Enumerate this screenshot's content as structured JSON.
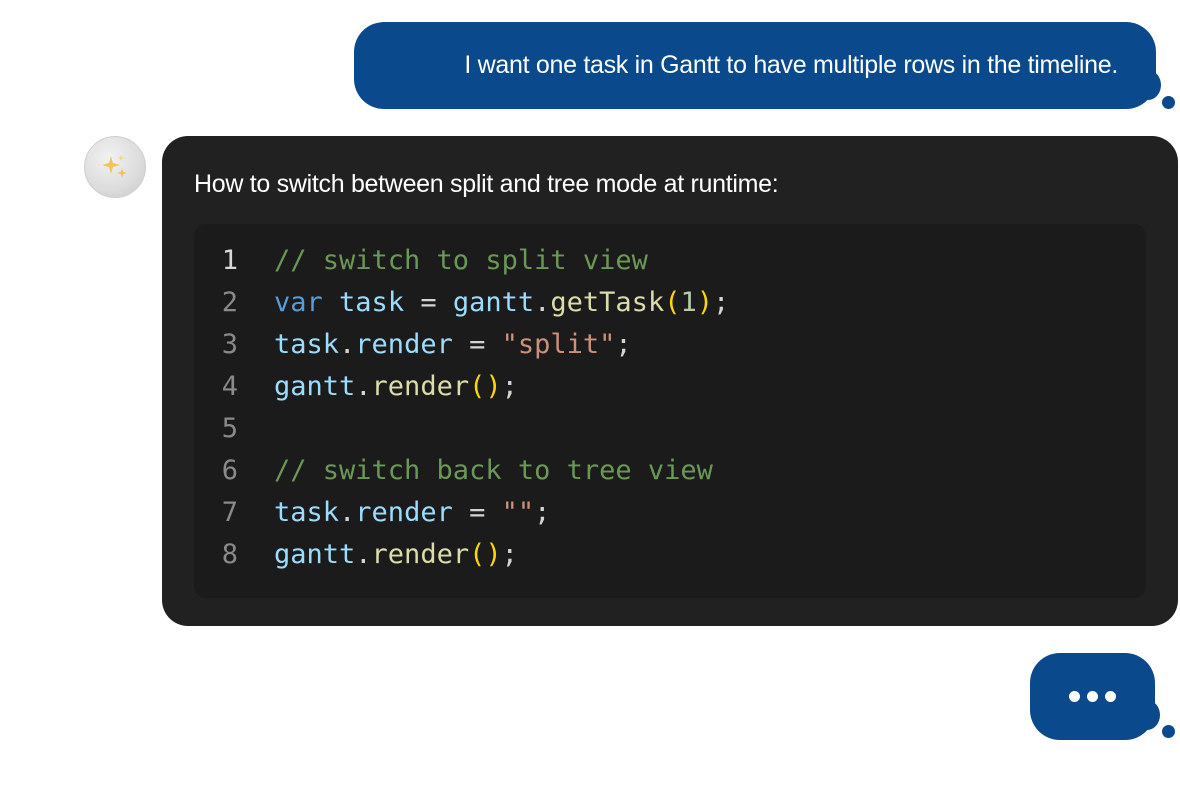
{
  "user_message": {
    "text": "I want one task in Gantt to have multiple rows in the timeline."
  },
  "assistant": {
    "avatar_icon": "sparkles-icon",
    "heading": "How to switch between split and tree mode at runtime:",
    "code_lines": [
      {
        "num": "1",
        "tokens": [
          {
            "t": "// switch to split view",
            "c": "comment"
          }
        ]
      },
      {
        "num": "2",
        "tokens": [
          {
            "t": "var",
            "c": "keyword"
          },
          {
            "t": " ",
            "c": "plain"
          },
          {
            "t": "task",
            "c": "var"
          },
          {
            "t": " = ",
            "c": "op"
          },
          {
            "t": "gantt",
            "c": "var"
          },
          {
            "t": ".",
            "c": "op"
          },
          {
            "t": "getTask",
            "c": "fn"
          },
          {
            "t": "(",
            "c": "paren"
          },
          {
            "t": "1",
            "c": "num"
          },
          {
            "t": ")",
            "c": "paren"
          },
          {
            "t": ";",
            "c": "plain"
          }
        ]
      },
      {
        "num": "3",
        "tokens": [
          {
            "t": "task",
            "c": "var"
          },
          {
            "t": ".",
            "c": "op"
          },
          {
            "t": "render",
            "c": "var"
          },
          {
            "t": " = ",
            "c": "op"
          },
          {
            "t": "\"split\"",
            "c": "str"
          },
          {
            "t": ";",
            "c": "plain"
          }
        ]
      },
      {
        "num": "4",
        "tokens": [
          {
            "t": "gantt",
            "c": "var"
          },
          {
            "t": ".",
            "c": "op"
          },
          {
            "t": "render",
            "c": "fn"
          },
          {
            "t": "()",
            "c": "paren"
          },
          {
            "t": ";",
            "c": "plain"
          }
        ]
      },
      {
        "num": "5",
        "tokens": []
      },
      {
        "num": "6",
        "tokens": [
          {
            "t": "// switch back to tree view",
            "c": "comment"
          }
        ]
      },
      {
        "num": "7",
        "tokens": [
          {
            "t": "task",
            "c": "var"
          },
          {
            "t": ".",
            "c": "op"
          },
          {
            "t": "render",
            "c": "var"
          },
          {
            "t": " = ",
            "c": "op"
          },
          {
            "t": "\"\"",
            "c": "str"
          },
          {
            "t": ";",
            "c": "plain"
          }
        ]
      },
      {
        "num": "8",
        "tokens": [
          {
            "t": "gantt",
            "c": "var"
          },
          {
            "t": ".",
            "c": "op"
          },
          {
            "t": "render",
            "c": "fn"
          },
          {
            "t": "()",
            "c": "paren"
          },
          {
            "t": ";",
            "c": "plain"
          }
        ]
      }
    ]
  },
  "typing_indicator": {
    "icon": "typing-dots-icon"
  },
  "colors": {
    "user_bubble": "#0a4a8c",
    "assistant_bubble": "#212121",
    "code_background": "#1b1b1b"
  }
}
